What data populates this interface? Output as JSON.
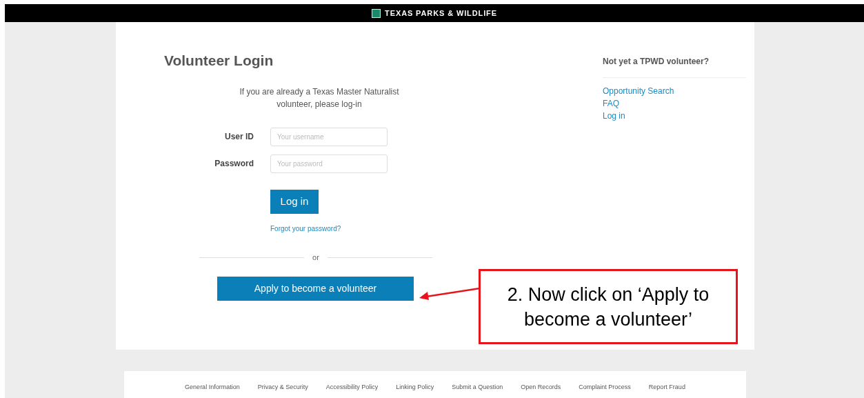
{
  "top_bar": {
    "brand": "TEXAS PARKS & WILDLIFE"
  },
  "login": {
    "title": "Volunteer Login",
    "intro": "If you are already a Texas Master Naturalist volunteer, please log-in",
    "fields": [
      {
        "label": "User ID",
        "placeholder": "Your username"
      },
      {
        "label": "Password",
        "placeholder": "Your password"
      }
    ],
    "submit": "Log in",
    "forgot": "Forgot your password?",
    "divider": "or",
    "apply": "Apply to become a volunteer"
  },
  "sidebar": {
    "heading": "Not yet a TPWD volunteer?",
    "links": [
      "Opportunity Search",
      "FAQ",
      "Log in"
    ]
  },
  "callout": {
    "text": "2. Now click on ‘Apply to become a volunteer’"
  },
  "footer": {
    "links": [
      "General Information",
      "Privacy & Security",
      "Accessibility Policy",
      "Linking Policy",
      "Submit a Question",
      "Open Records",
      "Complaint Process",
      "Report Fraud"
    ]
  }
}
